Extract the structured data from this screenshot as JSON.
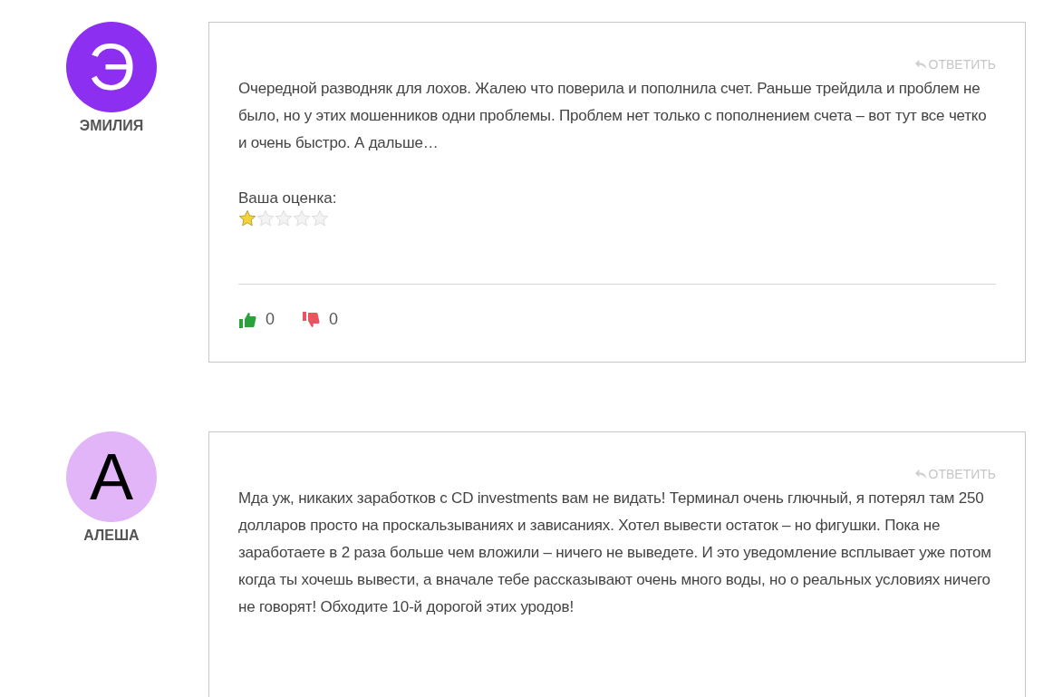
{
  "comments": [
    {
      "author": "ЭМИЛИЯ",
      "initial": "Э",
      "color": "#8c2ff0",
      "reply": "ОТВЕТИТЬ",
      "text": "Очередной разводняк для лохов. Жалею что поверила и пополнила счет. Раньше трейдила и проблем не было, но у этих мошенников одни проблемы. Проблем нет только с пополнением счета – вот тут все четко и очень быстро. А дальше…",
      "rating": {
        "label": "Ваша оценка:",
        "stars": 1
      },
      "votes": {
        "up": "0",
        "down": "0"
      }
    },
    {
      "author": "АЛЕША",
      "initial": "А",
      "color": "#e2b4f8",
      "reply": "ОТВЕТИТЬ",
      "text": "Мда уж, никаких заработков с CD investments вам не видать! Терминал очень глючный, я потерял там 250 долларов просто на проскальзываниях и зависаниях. Хотел вывести остаток – но фигушки. Пока не заработаете в 2 раза больше чем вложили – ничего не выведете. И это уведомление всплывает уже потом когда ты хочешь вывести, а вначале тебе рассказывают очень много воды, но о реальных условиях ничего не говорят! Обходите 10-й дорогой этих уродов!"
    }
  ]
}
